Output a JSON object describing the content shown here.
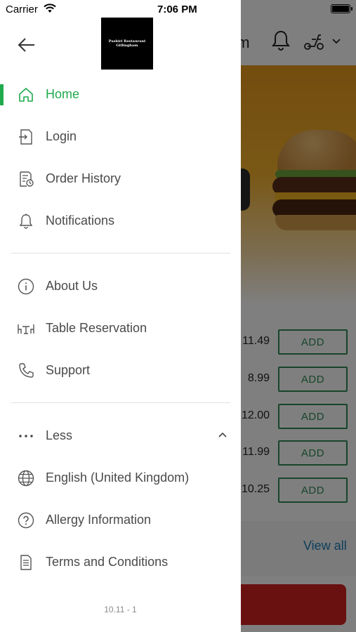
{
  "status_bar": {
    "carrier": "Carrier",
    "time": "7:06 PM"
  },
  "background": {
    "header_partial_text": "am",
    "prices": [
      "11.49",
      "8.99",
      "12.00",
      "11.99",
      "10.25"
    ],
    "add_label": "ADD",
    "view_all": "View all"
  },
  "drawer": {
    "logo": {
      "line1": "Pashiri Restaurant",
      "line2": "Gillingham"
    },
    "primary_items": [
      {
        "label": "Home",
        "icon": "home-icon",
        "active": true
      },
      {
        "label": "Login",
        "icon": "login-icon"
      },
      {
        "label": "Order History",
        "icon": "order-history-icon"
      },
      {
        "label": "Notifications",
        "icon": "bell-icon"
      }
    ],
    "secondary_items": [
      {
        "label": "About Us",
        "icon": "info-icon"
      },
      {
        "label": "Table Reservation",
        "icon": "table-icon"
      },
      {
        "label": "Support",
        "icon": "phone-icon"
      }
    ],
    "toggle": {
      "label": "Less",
      "icon": "more-dots-icon",
      "expanded": true
    },
    "tertiary_items": [
      {
        "label": "English (United Kingdom)",
        "icon": "globe-icon"
      },
      {
        "label": "Allergy Information",
        "icon": "question-icon"
      },
      {
        "label": "Terms and Conditions",
        "icon": "document-icon"
      }
    ],
    "version": "10.11 - 1"
  },
  "colors": {
    "accent": "#1faa4d",
    "add_button": "#2e8b57",
    "link": "#1a7db8",
    "cta": "#d32222"
  }
}
